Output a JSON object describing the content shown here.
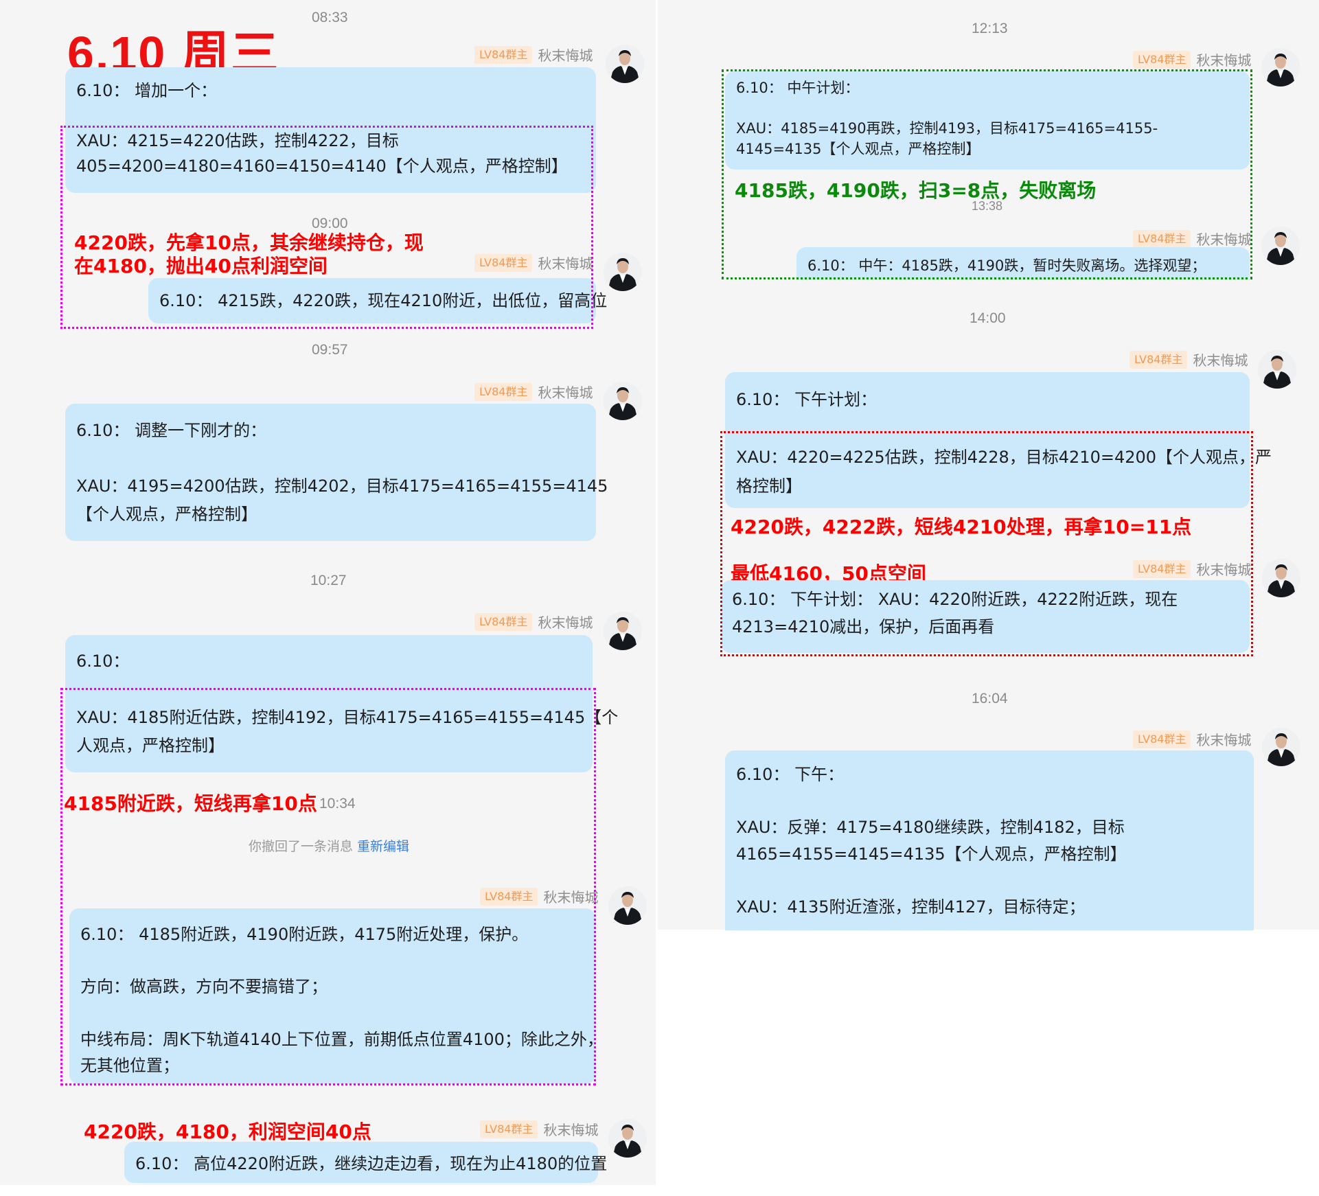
{
  "page_title": "6.10  周三",
  "user": {
    "badge": "LV84群主",
    "name": "秋末悔城"
  },
  "times": [
    "08:33",
    "09:00",
    "09:57",
    "10:27",
    "10:34",
    "12:13",
    "13:38",
    "14:00",
    "16:04"
  ],
  "left": {
    "m1_head": "6.10：  增加一个：",
    "m1_l1": "XAU：4215=4220估跌，控制4222，目标",
    "m1_l2": "405=4200=4180=4160=4150=4140【个人观点，严格控制】",
    "n1_l1": "4220跌，先拿10点，其余继续持仓，现",
    "n1_l2": "在4180，抛出40点利润空间",
    "m2": "6.10：  4215跌，4220跌，现在4210附近，出低位，留高位",
    "m3_head": "6.10：  调整一下刚才的：",
    "m3_l1": "XAU：4195=4200估跌，控制4202，目标4175=4165=4155=4145",
    "m3_l2": "【个人观点，严格控制】",
    "m4_head": "6.10：",
    "m4_l1": "XAU：4185附近估跌，控制4192，目标4175=4165=4155=4145【个",
    "m4_l2": "人观点，严格控制】",
    "n2": "4185附近跌，短线再拿10点",
    "recall_text": "你撤回了一条消息",
    "recall_link": "重新编辑",
    "m5_l1": "6.10：  4185附近跌，4190附近跌，4175附近处理，保护。",
    "m5_l2": "方向：做高跌，方向不要搞错了；",
    "m5_l3": "中线布局：周K下轨道4140上下位置，前期低点位置4100；除此之外，",
    "m5_l4": "无其他位置；",
    "n3": "4220跌，4180，利润空间40点",
    "m6": "6.10：  高位4220附近跌，继续边走边看，现在为止4180的位置"
  },
  "right": {
    "r1_head": "6.10：  中午计划：",
    "r1_l1": "XAU：4185=4190再跌，控制4193，目标4175=4165=4155-",
    "r1_l2": "4145=4135【个人观点，严格控制】",
    "rn1": "4185跌，4190跌，扫3=8点，失败离场",
    "r2": "6.10：  中午：4185跌，4190跌，暂时失败离场。选择观望；",
    "r3_head": "6.10：  下午计划：",
    "r3_l1": "XAU：4220=4225估跌，控制4228，目标4210=4200【个人观点，严",
    "r3_l2": "格控制】",
    "rn2": "4220跌，4222跌，短线4210处理，再拿10=11点",
    "rn3": "最低4160，50点空间",
    "r4_l1": "6.10：  下午计划：  XAU：4220附近跌，4222附近跌，现在",
    "r4_l2": "4213=4210减出，保护，后面再看",
    "r5_head": "6.10：  下午：",
    "r5_l1": "XAU：反弹：4175=4180继续跌，控制4182，目标",
    "r5_l2": "4165=4155=4145=4135【个人观点，严格控制】",
    "r5_l3": "XAU：4135附近渣涨，控制4127，目标待定；"
  }
}
